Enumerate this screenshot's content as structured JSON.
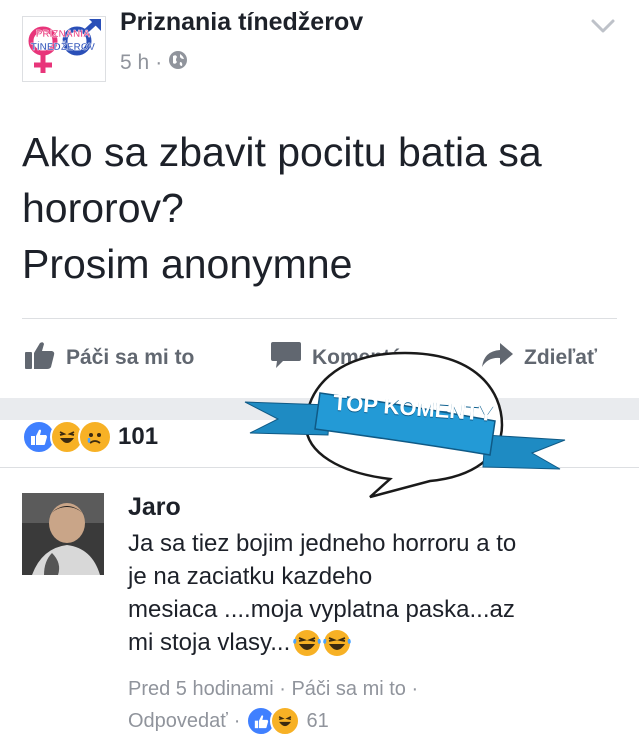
{
  "post": {
    "page_name": "Priznania tínedžerov",
    "time": "5 h",
    "logo_text": [
      "PRIZNANIA",
      "TÍNEDŽEROV"
    ],
    "lines": [
      "Ako sa zbavit pocitu batia sa",
      "hororov?",
      "Prosim anonymne"
    ]
  },
  "actions": {
    "like": "Páči sa mi to",
    "comment": "Komentár",
    "share": "Zdieľať"
  },
  "reactions": {
    "count": "101",
    "icons": [
      "like-icon",
      "haha-icon",
      "sad-icon"
    ]
  },
  "badge": {
    "text": "TOP KOMENTY",
    "ribbon_color": "#1e8bc3",
    "bubble_color": "#ffffff"
  },
  "comment": {
    "author": "Jaro",
    "lines": [
      "Ja sa tiez bojim jedneho horroru a to",
      "je na zaciatku kazdeho",
      "mesiaca ....moja vyplatna paska...az",
      "mi stoja vlasy..."
    ],
    "emoji": [
      "haha-emoji",
      "haha-emoji"
    ],
    "time": "Pred 5 hodinami",
    "like": "Páči sa mi to",
    "reply": "Odpovedať",
    "reaction_count": "61"
  },
  "colors": {
    "fb_blue": "#4080ff",
    "gray_text": "#90949c",
    "action_text": "#616770"
  }
}
